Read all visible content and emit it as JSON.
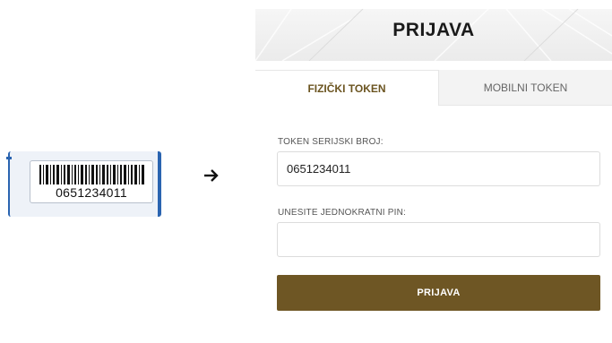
{
  "token_illustration": {
    "serial_number": "0651234011",
    "barcode_icon": "barcode-icon",
    "arrow_icon": "arrow-right-icon"
  },
  "login": {
    "title": "PRIJAVA",
    "tabs": [
      {
        "label": "FIZIČKI TOKEN",
        "active": true
      },
      {
        "label": "MOBILNI TOKEN",
        "active": false
      }
    ],
    "serial_label": "TOKEN SERIJSKI BROJ:",
    "serial_value": "0651234011",
    "pin_label": "UNESITE JEDNOKRATNI PIN:",
    "pin_value": "",
    "submit_label": "PRIJAVA"
  },
  "colors": {
    "accent": "#6e5624",
    "active_tab_text": "#6b5420",
    "token_border": "#2a64b0"
  }
}
